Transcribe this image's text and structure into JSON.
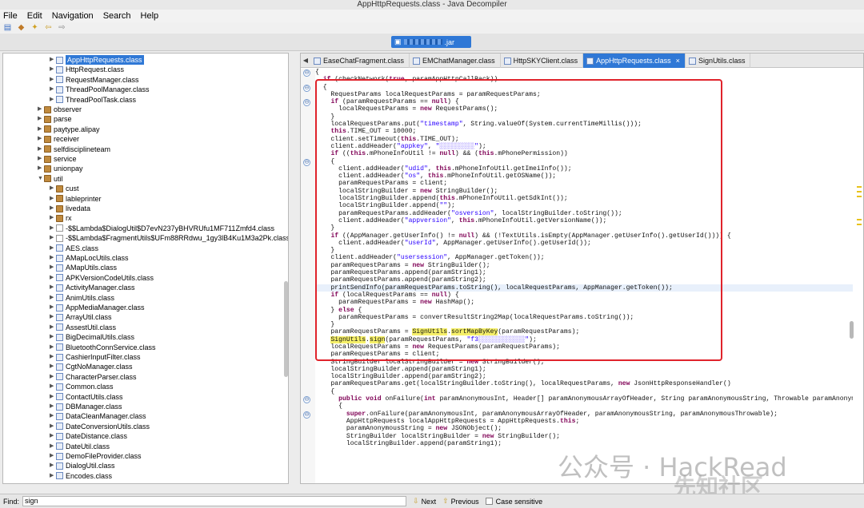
{
  "window": {
    "title": "AppHttpRequests.class - Java Decompiler"
  },
  "menu": [
    "File",
    "Edit",
    "Navigation",
    "Search",
    "Help"
  ],
  "jar_tab": {
    "label_suffix": ".jar",
    "close": "×"
  },
  "tree": [
    {
      "label": "AppHttpRequests.class",
      "type": "cls",
      "depth": 2,
      "arrow": "▶",
      "selected": true
    },
    {
      "label": "HttpRequest.class",
      "type": "cls",
      "depth": 2,
      "arrow": "▶"
    },
    {
      "label": "RequestManager.class",
      "type": "cls",
      "depth": 2,
      "arrow": "▶"
    },
    {
      "label": "ThreadPoolManager.class",
      "type": "cls",
      "depth": 2,
      "arrow": "▶"
    },
    {
      "label": "ThreadPoolTask.class",
      "type": "cls",
      "depth": 2,
      "arrow": "▶"
    },
    {
      "label": "observer",
      "type": "pkg",
      "depth": 1,
      "arrow": "▶"
    },
    {
      "label": "parse",
      "type": "pkg",
      "depth": 1,
      "arrow": "▶"
    },
    {
      "label": "paytype.alipay",
      "type": "pkg",
      "depth": 1,
      "arrow": "▶"
    },
    {
      "label": "receiver",
      "type": "pkg",
      "depth": 1,
      "arrow": "▶"
    },
    {
      "label": "selfdisciplineteam",
      "type": "pkg",
      "depth": 1,
      "arrow": "▶"
    },
    {
      "label": "service",
      "type": "pkg",
      "depth": 1,
      "arrow": "▶"
    },
    {
      "label": "unionpay",
      "type": "pkg",
      "depth": 1,
      "arrow": "▶"
    },
    {
      "label": "util",
      "type": "pkg",
      "depth": 1,
      "arrow": "▼"
    },
    {
      "label": "cust",
      "type": "pkg",
      "depth": 2,
      "arrow": "▶"
    },
    {
      "label": "lableprinter",
      "type": "pkg",
      "depth": 2,
      "arrow": "▶"
    },
    {
      "label": "livedata",
      "type": "pkg",
      "depth": 2,
      "arrow": "▶"
    },
    {
      "label": "rx",
      "type": "pkg",
      "depth": 2,
      "arrow": "▶"
    },
    {
      "label": "-$$Lambda$DialogUtil$D7evN237yBHVRUfu1MF711Zmfd4.class",
      "type": "lam",
      "depth": 2,
      "arrow": "▶"
    },
    {
      "label": "-$$Lambda$FragmentUtils$UFm88RRdwu_1gy3lB4Ku1M3a2Pk.class",
      "type": "lam",
      "depth": 2,
      "arrow": "▶"
    },
    {
      "label": "AES.class",
      "type": "cls",
      "depth": 2,
      "arrow": "▶"
    },
    {
      "label": "AMapLocUtils.class",
      "type": "cls",
      "depth": 2,
      "arrow": "▶"
    },
    {
      "label": "AMapUtils.class",
      "type": "cls",
      "depth": 2,
      "arrow": "▶"
    },
    {
      "label": "APKVersionCodeUtils.class",
      "type": "cls",
      "depth": 2,
      "arrow": "▶"
    },
    {
      "label": "ActivityManager.class",
      "type": "cls",
      "depth": 2,
      "arrow": "▶"
    },
    {
      "label": "AnimUtils.class",
      "type": "cls",
      "depth": 2,
      "arrow": "▶"
    },
    {
      "label": "AppMediaManager.class",
      "type": "cls",
      "depth": 2,
      "arrow": "▶"
    },
    {
      "label": "ArrayUtil.class",
      "type": "cls",
      "depth": 2,
      "arrow": "▶"
    },
    {
      "label": "AssestUtil.class",
      "type": "cls",
      "depth": 2,
      "arrow": "▶"
    },
    {
      "label": "BigDecimalUtils.class",
      "type": "cls",
      "depth": 2,
      "arrow": "▶"
    },
    {
      "label": "BluetoothConnService.class",
      "type": "cls",
      "depth": 2,
      "arrow": "▶"
    },
    {
      "label": "CashierInputFilter.class",
      "type": "cls",
      "depth": 2,
      "arrow": "▶"
    },
    {
      "label": "CgtNoManager.class",
      "type": "cls",
      "depth": 2,
      "arrow": "▶"
    },
    {
      "label": "CharacterParser.class",
      "type": "cls",
      "depth": 2,
      "arrow": "▶"
    },
    {
      "label": "Common.class",
      "type": "cls",
      "depth": 2,
      "arrow": "▶"
    },
    {
      "label": "ContactUtils.class",
      "type": "cls",
      "depth": 2,
      "arrow": "▶"
    },
    {
      "label": "DBManager.class",
      "type": "cls",
      "depth": 2,
      "arrow": "▶"
    },
    {
      "label": "DataCleanManager.class",
      "type": "cls",
      "depth": 2,
      "arrow": "▶"
    },
    {
      "label": "DateConversionUtils.class",
      "type": "cls",
      "depth": 2,
      "arrow": "▶"
    },
    {
      "label": "DateDistance.class",
      "type": "cls",
      "depth": 2,
      "arrow": "▶"
    },
    {
      "label": "DateUtil.class",
      "type": "cls",
      "depth": 2,
      "arrow": "▶"
    },
    {
      "label": "DemoFileProvider.class",
      "type": "cls",
      "depth": 2,
      "arrow": "▶"
    },
    {
      "label": "DialogUtil.class",
      "type": "cls",
      "depth": 2,
      "arrow": "▶"
    },
    {
      "label": "Encodes.class",
      "type": "cls",
      "depth": 2,
      "arrow": "▶"
    }
  ],
  "tabs": [
    {
      "label": "EaseChatFragment.class",
      "active": false
    },
    {
      "label": "EMChatManager.class",
      "active": false
    },
    {
      "label": "HttpSKYClient.class",
      "active": false
    },
    {
      "label": "AppHttpRequests.class",
      "active": true,
      "close": "×"
    },
    {
      "label": "SignUtils.class",
      "active": false
    }
  ],
  "tab_arrow": "◀",
  "code_lines": [
    "{",
    "  if (checkNetwork(true, paramAppHttpCallBack))",
    "  {",
    "    RequestParams localRequestParams = paramRequestParams;",
    "    if (paramRequestParams == null) {",
    "      localRequestParams = new RequestParams();",
    "    }",
    "    localRequestParams.put(\"timestamp\", String.valueOf(System.currentTimeMillis()));",
    "    this.TIME_OUT = 10000;",
    "    client.setTimeout(this.TIME_OUT);",
    "    client.addHeader(\"appkey\", \"░░░░░░░░░\");",
    "    if ((this.mPhoneInfoUtil != null) && (this.mPhonePermission))",
    "    {",
    "      client.addHeader(\"udid\", this.mPhoneInfoUtil.getImeiInfo());",
    "      client.addHeader(\"os\", this.mPhoneInfoUtil.getOSName());",
    "      paramRequestParams = client;",
    "      localStringBuilder = new StringBuilder();",
    "      localStringBuilder.append(this.mPhoneInfoUtil.getSdkInt());",
    "      localStringBuilder.append(\"\");",
    "      paramRequestParams.addHeader(\"osversion\", localStringBuilder.toString());",
    "      client.addHeader(\"appversion\", this.mPhoneInfoUtil.getVersionName());",
    "    }",
    "    if ((AppManager.getUserInfo() != null) && (!TextUtils.isEmpty(AppManager.getUserInfo().getUserId()))) {",
    "      client.addHeader(\"userId\", AppManager.getUserInfo().getUserId());",
    "    }",
    "    client.addHeader(\"usersession\", AppManager.getToken());",
    "    paramRequestParams = new StringBuilder();",
    "    paramRequestParams.append(paramString1);",
    "    paramRequestParams.append(paramString2);",
    "    printSendInfo(paramRequestParams.toString(), localRequestParams, AppManager.getToken());",
    "    if (localRequestParams == null) {",
    "      paramRequestParams = new HashMap();",
    "    } else {",
    "      paramRequestParams = convertResultString2Map(localRequestParams.toString());",
    "    }",
    "    paramRequestParams = SignUtils.sortMapByKey(paramRequestParams);",
    "    SignUtils.sign(paramRequestParams, \"f3░░░░░░░░░░░░\");",
    "    localRequestParams = new RequestParams(paramRequestParams);",
    "    paramRequestParams = client;",
    "    StringBuilder localStringBuilder = new StringBuilder();",
    "    localStringBuilder.append(paramString1);",
    "    localStringBuilder.append(paramString2);",
    "    paramRequestParams.get(localStringBuilder.toString(), localRequestParams, new JsonHttpResponseHandler()",
    "    {",
    "      public void onFailure(int paramAnonymousInt, Header[] paramAnonymousArrayOfHeader, String paramAnonymousString, Throwable paramAnonymousThro",
    "      {",
    "        super.onFailure(paramAnonymousInt, paramAnonymousArrayOfHeader, paramAnonymousString, paramAnonymousThrowable);",
    "        AppHttpRequests localAppHttpRequests = AppHttpRequests.this;",
    "        paramAnonymousString = new JSONObject();",
    "        StringBuilder localStringBuilder = new StringBuilder();",
    "        localStringBuilder.append(paramString1);"
  ],
  "find": {
    "label": "Find:",
    "value": "sign",
    "next": "Next",
    "previous": "Previous",
    "case_sensitive": "Case sensitive"
  },
  "watermark": {
    "line1": "公众号 · HackRead",
    "line2": "先知社区"
  }
}
